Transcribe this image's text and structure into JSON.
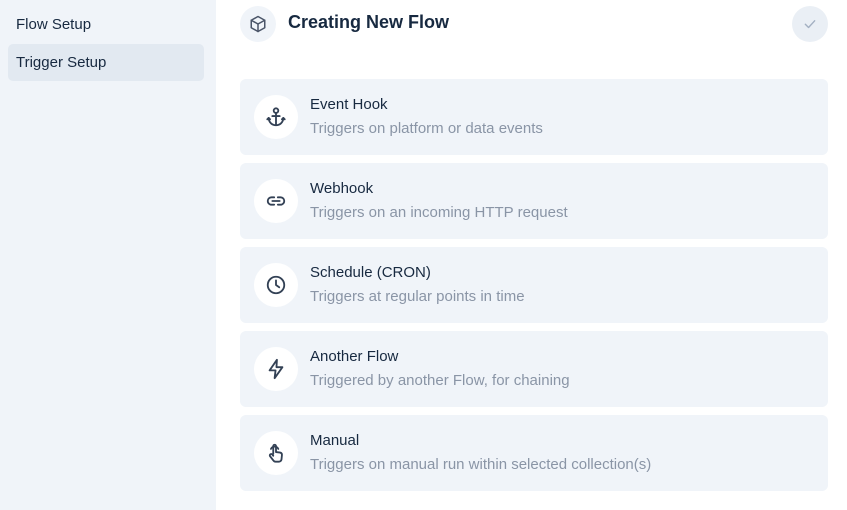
{
  "sidebar": {
    "items": [
      {
        "label": "Flow Setup",
        "active": false
      },
      {
        "label": "Trigger Setup",
        "active": true
      }
    ]
  },
  "header": {
    "title": "Creating New Flow",
    "icon": "cube-icon",
    "confirm_icon": "check-icon"
  },
  "triggers": [
    {
      "title": "Event Hook",
      "description": "Triggers on platform or data events",
      "icon": "anchor-icon"
    },
    {
      "title": "Webhook",
      "description": "Triggers on an incoming HTTP request",
      "icon": "link-icon"
    },
    {
      "title": "Schedule (CRON)",
      "description": "Triggers at regular points in time",
      "icon": "clock-icon"
    },
    {
      "title": "Another Flow",
      "description": "Triggered by another Flow, for chaining",
      "icon": "bolt-icon"
    },
    {
      "title": "Manual",
      "description": "Triggers on manual run within selected collection(s)",
      "icon": "pointer-icon"
    }
  ],
  "colors": {
    "sidebar_bg": "#f0f4f9",
    "active_item_bg": "#e2e9f1",
    "card_bg": "#f0f4f9",
    "text_primary": "#172940",
    "text_secondary": "#8a95a6"
  }
}
